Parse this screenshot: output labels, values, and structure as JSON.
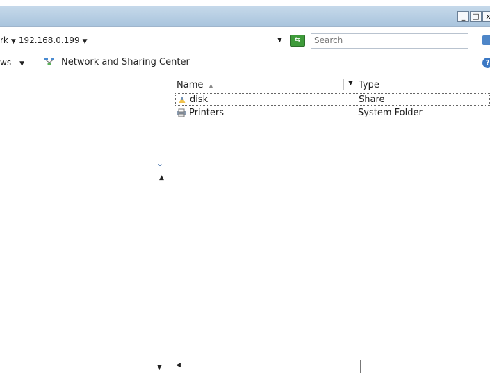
{
  "window": {
    "minimize_label": "_",
    "maximize_label": "□",
    "close_label": "x"
  },
  "address": {
    "crumbs": [
      "rk",
      "192.168.0.199"
    ],
    "refresh_icon": "refresh-arrows-icon"
  },
  "search": {
    "placeholder": "Search"
  },
  "toolbar": {
    "views_label": "ws",
    "network_sharing_label": "Network and Sharing Center",
    "help_label": "?"
  },
  "columns": {
    "name": "Name",
    "type": "Type"
  },
  "items": [
    {
      "name": "disk",
      "type": "Share",
      "icon": "shared-folder-icon",
      "selected": true
    },
    {
      "name": "Printers",
      "type": "System Folder",
      "icon": "printer-folder-icon",
      "selected": false
    }
  ],
  "colors": {
    "titlebar": "#b8cfe5",
    "selection_border": "#666666",
    "refresh_green": "#3e9b3a",
    "search_blue": "#4e86c8"
  }
}
